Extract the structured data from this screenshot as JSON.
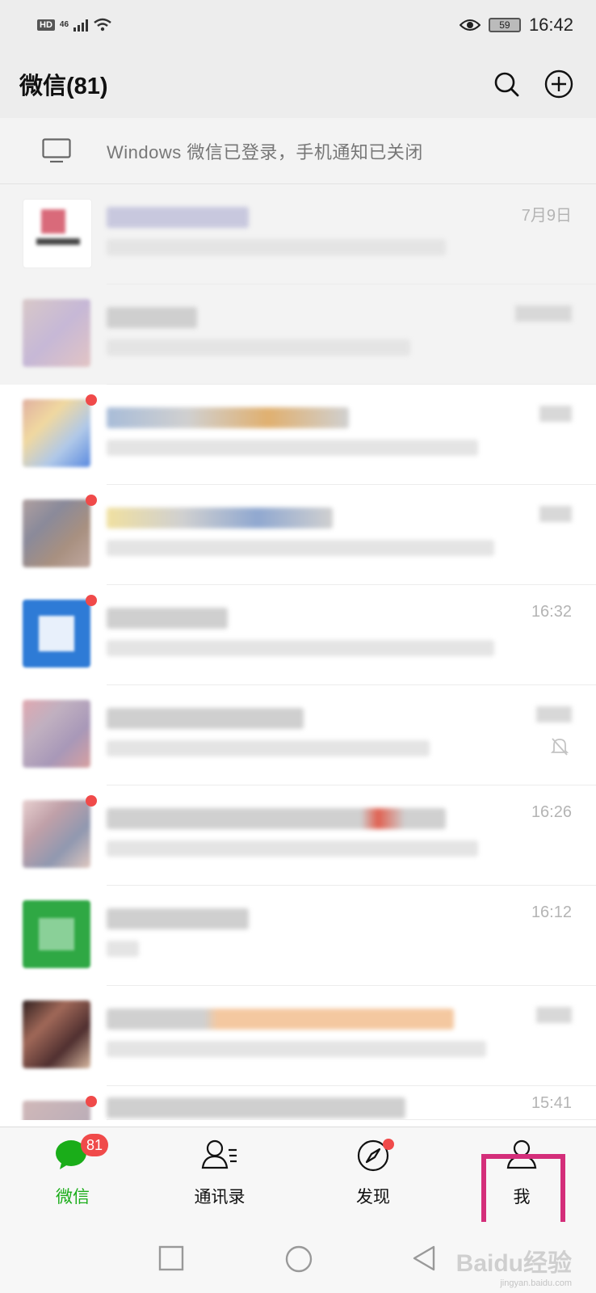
{
  "status_bar": {
    "hd": "HD",
    "network": "46",
    "battery": "59",
    "time": "16:42"
  },
  "header": {
    "title": "微信(81)"
  },
  "banner": {
    "text": "Windows 微信已登录，手机通知已关闭"
  },
  "chats": [
    {
      "time": "7月9日"
    },
    {
      "time": ""
    },
    {
      "time": ""
    },
    {
      "time": ""
    },
    {
      "time": "16:32"
    },
    {
      "time": ""
    },
    {
      "time": "16:26"
    },
    {
      "time": "16:12"
    },
    {
      "time": ""
    },
    {
      "time": "15:41"
    }
  ],
  "tabs": [
    {
      "label": "微信",
      "badge": "81"
    },
    {
      "label": "通讯录"
    },
    {
      "label": "发现"
    },
    {
      "label": "我"
    }
  ],
  "watermark": {
    "brand": "Baidu经验",
    "url": "jingyan.baidu.com"
  },
  "colors": {
    "accent": "#1aad19",
    "badge": "#f04a4a",
    "highlight": "#d42e7a"
  }
}
